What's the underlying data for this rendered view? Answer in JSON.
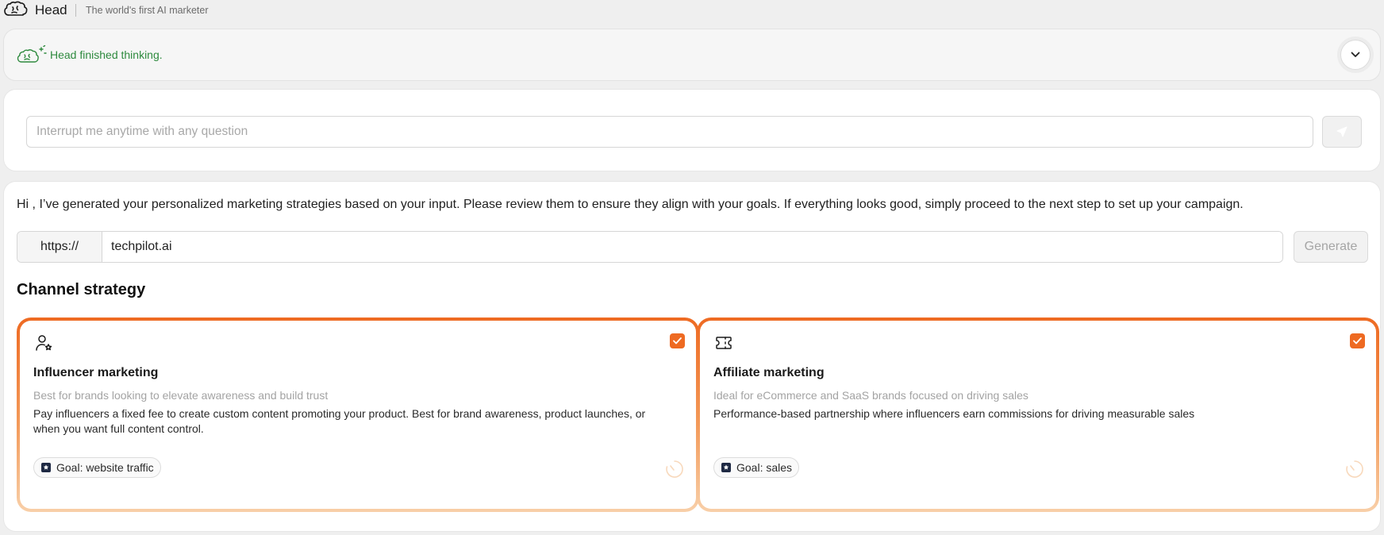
{
  "app": {
    "name": "Head",
    "tagline": "The world's first AI marketer"
  },
  "status": {
    "text": "Head finished thinking."
  },
  "chat_input": {
    "placeholder": "Interrupt me anytime with any question"
  },
  "main": {
    "intro": "Hi , I’ve generated your personalized marketing strategies based on your input. Please review them to ensure they align with your goals. If everything looks good, simply proceed to the next step to set up your campaign.",
    "url_prefix": "https://",
    "url_value": "techpilot.ai",
    "generate_label": "Generate",
    "section_title": "Channel strategy"
  },
  "strategies": [
    {
      "icon": "user-star-icon",
      "checked": true,
      "title": "Influencer marketing",
      "subtitle": "Best for brands looking to elevate awareness and build trust",
      "description": "Pay influencers a fixed fee to create custom content promoting your product. Best for brand awareness, product launches, or when you want full content control.",
      "goal": "Goal: website traffic"
    },
    {
      "icon": "ticket-icon",
      "checked": true,
      "title": "Affiliate marketing",
      "subtitle": "Ideal for eCommerce and SaaS brands focused on driving sales",
      "description": "Performance-based partnership where influencers earn commissions for driving measurable sales",
      "goal": "Goal: sales"
    }
  ],
  "colors": {
    "accent": "#ee6a22",
    "status_green": "#2e8a3e"
  }
}
